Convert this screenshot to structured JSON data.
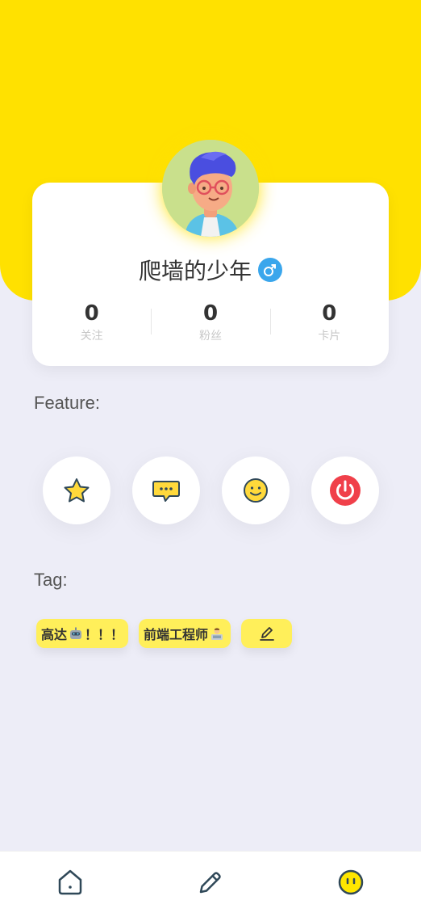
{
  "profile": {
    "username": "爬墙的少年",
    "gender_icon": "male-icon",
    "stats": [
      {
        "value": "0",
        "label": "关注"
      },
      {
        "value": "0",
        "label": "粉丝"
      },
      {
        "value": "0",
        "label": "卡片"
      }
    ]
  },
  "sections": {
    "feature_title": "Feature:",
    "tag_title": "Tag:"
  },
  "features": [
    {
      "icon": "star-icon"
    },
    {
      "icon": "message-icon"
    },
    {
      "icon": "smile-icon"
    },
    {
      "icon": "power-icon"
    }
  ],
  "tags": [
    {
      "text_before": "高达",
      "emoji": "robot-icon",
      "text_after": "！！！"
    },
    {
      "text_before": "前端工程师",
      "emoji": "technologist-icon",
      "text_after": ""
    }
  ],
  "nav": [
    {
      "icon": "home-icon"
    },
    {
      "icon": "pen-icon"
    },
    {
      "icon": "face-icon"
    }
  ],
  "colors": {
    "header": "#ffe100",
    "tag": "#ffef5a",
    "gender": "#3aa6ec",
    "power": "#f0404a",
    "background": "#ededf7"
  }
}
